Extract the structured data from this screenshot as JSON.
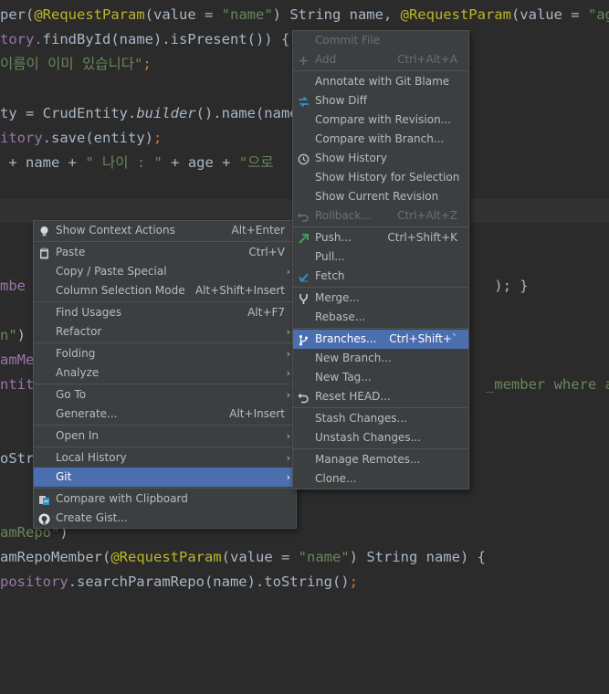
{
  "code_lines": [
    [
      [
        "per(",
        ""
      ],
      [
        "@RequestParam",
        "ann"
      ],
      [
        "(value = ",
        ""
      ],
      [
        "\"name\"",
        "str"
      ],
      [
        ") String name, ",
        ""
      ],
      [
        "@RequestParam",
        "ann"
      ],
      [
        "(value = ",
        ""
      ],
      [
        "\"age\"",
        "str"
      ],
      [
        ")",
        ""
      ]
    ],
    [
      [
        "tory.",
        "fld"
      ],
      [
        "findById(name).isPresent()) {",
        ""
      ]
    ],
    [
      [
        "이름이 이미 있습니다\"",
        "str"
      ],
      [
        ";",
        "kw"
      ]
    ],
    [],
    [
      [
        "ty = CrudEntity.",
        ""
      ],
      [
        "builder",
        "itl"
      ],
      [
        "().name(name)",
        ""
      ]
    ],
    [
      [
        "itory",
        "fld"
      ],
      [
        ".save(entity)",
        ""
      ],
      [
        ";",
        "kw"
      ]
    ],
    [
      [
        " + name + ",
        ""
      ],
      [
        "\" 나이 : \"",
        "str"
      ],
      [
        " + age + ",
        ""
      ],
      [
        "\"으로 ",
        "str"
      ]
    ],
    [],
    [],
    [],
    [],
    [
      [
        "mbe",
        "fld"
      ],
      [
        "                                                       ",
        ""
      ],
      [
        "); }",
        ""
      ]
    ],
    [],
    [
      [
        "n\"",
        "str"
      ],
      [
        ")",
        ""
      ]
    ],
    [
      [
        "amMem",
        "fld"
      ]
    ],
    [
      [
        "ntity",
        "fld"
      ],
      [
        "                                                    ",
        ""
      ],
      [
        "_member where age ",
        "str"
      ]
    ],
    [],
    [],
    [
      [
        "oStri",
        ""
      ]
    ],
    [],
    [],
    [
      [
        "amRepo\"",
        "str"
      ],
      [
        ")",
        ""
      ]
    ],
    [
      [
        "amRepoMember(",
        ""
      ],
      [
        "@RequestParam",
        "ann"
      ],
      [
        "(value = ",
        ""
      ],
      [
        "\"name\"",
        "str"
      ],
      [
        ") String name) {",
        ""
      ]
    ],
    [
      [
        "pository",
        "fld"
      ],
      [
        ".searchParamRepo(name).toString()",
        ""
      ],
      [
        ";",
        "kw"
      ]
    ]
  ],
  "context_menu": {
    "items": [
      {
        "label": "Show Context Actions",
        "shortcut": "Alt+Enter",
        "icon": "lightbulb-icon"
      },
      {
        "sep": true
      },
      {
        "label": "Paste",
        "shortcut": "Ctrl+V",
        "icon": "clipboard-icon"
      },
      {
        "label": "Copy / Paste Special",
        "submenu": true
      },
      {
        "label": "Column Selection Mode",
        "shortcut": "Alt+Shift+Insert"
      },
      {
        "sep": true
      },
      {
        "label": "Find Usages",
        "shortcut": "Alt+F7"
      },
      {
        "label": "Refactor",
        "submenu": true
      },
      {
        "sep": true
      },
      {
        "label": "Folding",
        "submenu": true
      },
      {
        "label": "Analyze",
        "submenu": true
      },
      {
        "sep": true
      },
      {
        "label": "Go To",
        "submenu": true
      },
      {
        "label": "Generate...",
        "shortcut": "Alt+Insert"
      },
      {
        "sep": true
      },
      {
        "label": "Open In",
        "submenu": true
      },
      {
        "sep": true
      },
      {
        "label": "Local History",
        "submenu": true
      },
      {
        "label": "Git",
        "submenu": true,
        "selected": true
      },
      {
        "sep": true
      },
      {
        "label": "Compare with Clipboard",
        "icon": "compare-clipboard-icon"
      },
      {
        "label": "Create Gist...",
        "icon": "github-icon"
      }
    ]
  },
  "git_menu": {
    "items": [
      {
        "label": "Commit File",
        "disabled": true
      },
      {
        "label": "Add",
        "shortcut": "Ctrl+Alt+A",
        "disabled": true,
        "icon": "plus-icon"
      },
      {
        "sep": true
      },
      {
        "label": "Annotate with Git Blame"
      },
      {
        "label": "Show Diff",
        "icon": "diff-arrows-icon"
      },
      {
        "label": "Compare with Revision..."
      },
      {
        "label": "Compare with Branch..."
      },
      {
        "label": "Show History",
        "icon": "clock-icon"
      },
      {
        "label": "Show History for Selection"
      },
      {
        "label": "Show Current Revision"
      },
      {
        "label": "Rollback...",
        "shortcut": "Ctrl+Alt+Z",
        "disabled": true,
        "icon": "rollback-icon"
      },
      {
        "sep": true
      },
      {
        "label": "Push...",
        "shortcut": "Ctrl+Shift+K",
        "icon": "push-arrow-icon"
      },
      {
        "label": "Pull..."
      },
      {
        "label": "Fetch",
        "icon": "fetch-check-icon"
      },
      {
        "sep": true
      },
      {
        "label": "Merge...",
        "icon": "merge-icon"
      },
      {
        "label": "Rebase..."
      },
      {
        "sep": true
      },
      {
        "label": "Branches...",
        "shortcut": "Ctrl+Shift+`",
        "selected": true,
        "icon": "branch-icon"
      },
      {
        "label": "New Branch..."
      },
      {
        "label": "New Tag..."
      },
      {
        "label": "Reset HEAD...",
        "icon": "reset-icon"
      },
      {
        "sep": true
      },
      {
        "label": "Stash Changes..."
      },
      {
        "label": "Unstash Changes..."
      },
      {
        "sep": true
      },
      {
        "label": "Manage Remotes..."
      },
      {
        "label": "Clone..."
      }
    ]
  },
  "colors": {
    "editor_bg": "#2b2b2b",
    "menu_bg": "#3c3f41",
    "selection": "#4b6eaf"
  }
}
